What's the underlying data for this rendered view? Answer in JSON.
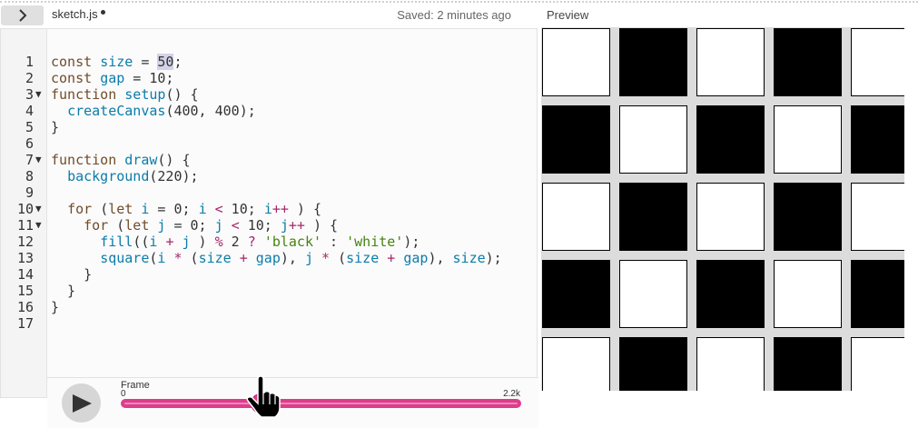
{
  "header": {
    "filename": "sketch.js",
    "saved_status": "Saved: 2 minutes ago",
    "preview_label": "Preview",
    "toggle_icon": "chevron-right-icon"
  },
  "editor": {
    "lines": [
      {
        "n": "1",
        "fold": false,
        "tokens": [
          [
            "kw",
            "const "
          ],
          [
            "var",
            "size"
          ],
          [
            "",
            "  = "
          ],
          [
            "hl",
            "50"
          ],
          [
            "",
            ";"
          ]
        ]
      },
      {
        "n": "2",
        "fold": false,
        "tokens": [
          [
            "kw",
            "const "
          ],
          [
            "var",
            "gap"
          ],
          [
            "",
            ""
          ],
          [
            "",
            ""
          ],
          [
            "",
            ""
          ]
        ]
      },
      {
        "n": "3",
        "fold": true,
        "tokens": []
      },
      {
        "n": "4",
        "fold": false,
        "tokens": []
      },
      {
        "n": "5",
        "fold": false,
        "tokens": []
      },
      {
        "n": "6",
        "fold": false,
        "tokens": []
      },
      {
        "n": "7",
        "fold": true,
        "tokens": []
      },
      {
        "n": "8",
        "fold": false,
        "tokens": []
      },
      {
        "n": "9",
        "fold": false,
        "tokens": []
      },
      {
        "n": "10",
        "fold": true,
        "tokens": []
      },
      {
        "n": "11",
        "fold": true,
        "tokens": []
      },
      {
        "n": "12",
        "fold": false,
        "tokens": []
      },
      {
        "n": "13",
        "fold": false,
        "tokens": []
      },
      {
        "n": "14",
        "fold": false,
        "tokens": []
      },
      {
        "n": "15",
        "fold": false,
        "tokens": []
      },
      {
        "n": "16",
        "fold": false,
        "tokens": []
      },
      {
        "n": "17",
        "fold": false,
        "tokens": []
      }
    ],
    "code": [
      [
        [
          "kw",
          "const "
        ],
        [
          "var",
          "size"
        ],
        [
          "",
          " = "
        ],
        [
          "hl",
          "50"
        ],
        [
          "",
          ";"
        ]
      ],
      [
        [
          "kw",
          "const "
        ],
        [
          "var",
          "gap"
        ],
        [
          "",
          " = 10;"
        ]
      ],
      [
        [
          "kw",
          "function "
        ],
        [
          "var",
          "setup"
        ],
        [
          "",
          "() {"
        ]
      ],
      [
        [
          "",
          "  "
        ],
        [
          "var",
          "createCanvas"
        ],
        [
          "",
          "(400, 400);"
        ]
      ],
      [
        [
          "",
          "}"
        ]
      ],
      [],
      [
        [
          "kw",
          "function "
        ],
        [
          "var",
          "draw"
        ],
        [
          "",
          "() {"
        ]
      ],
      [
        [
          "",
          "  "
        ],
        [
          "var",
          "background"
        ],
        [
          "",
          "(220);"
        ]
      ],
      [],
      [
        [
          "",
          "  "
        ],
        [
          "kw",
          "for "
        ],
        [
          "",
          "("
        ],
        [
          "kw",
          "let "
        ],
        [
          "var",
          "i"
        ],
        [
          "",
          " = 0; "
        ],
        [
          "var",
          "i"
        ],
        [
          "",
          " "
        ],
        [
          "op",
          "<"
        ],
        [
          "",
          " 10; "
        ],
        [
          "var",
          "i"
        ],
        [
          "op",
          "++"
        ],
        [
          "",
          " ) {"
        ]
      ],
      [
        [
          "",
          "    "
        ],
        [
          "kw",
          "for "
        ],
        [
          "",
          "("
        ],
        [
          "kw",
          "let "
        ],
        [
          "var",
          "j"
        ],
        [
          "",
          " = 0; "
        ],
        [
          "var",
          "j"
        ],
        [
          "",
          " "
        ],
        [
          "op",
          "<"
        ],
        [
          "",
          " 10; "
        ],
        [
          "var",
          "j"
        ],
        [
          "op",
          "++"
        ],
        [
          "",
          " ) {"
        ]
      ],
      [
        [
          "",
          "      "
        ],
        [
          "var",
          "fill"
        ],
        [
          "",
          "(("
        ],
        [
          "var",
          "i"
        ],
        [
          "",
          " "
        ],
        [
          "op",
          "+"
        ],
        [
          "",
          " "
        ],
        [
          "var",
          "j"
        ],
        [
          "",
          " ) "
        ],
        [
          "op",
          "%"
        ],
        [
          "",
          " 2 "
        ],
        [
          "op",
          "?"
        ],
        [
          "",
          " "
        ],
        [
          "str",
          "'black'"
        ],
        [
          "",
          " : "
        ],
        [
          "str",
          "'white'"
        ],
        [
          "",
          ");"
        ]
      ],
      [
        [
          "",
          "      "
        ],
        [
          "var",
          "square"
        ],
        [
          "",
          "("
        ],
        [
          "var",
          "i"
        ],
        [
          "",
          " "
        ],
        [
          "op",
          "*"
        ],
        [
          "",
          " ("
        ],
        [
          "var",
          "size"
        ],
        [
          "",
          " "
        ],
        [
          "op",
          "+"
        ],
        [
          "",
          " "
        ],
        [
          "var",
          "gap"
        ],
        [
          "",
          "), "
        ],
        [
          "var",
          "j"
        ],
        [
          "",
          " "
        ],
        [
          "op",
          "*"
        ],
        [
          "",
          " ("
        ],
        [
          "var",
          "size"
        ],
        [
          "",
          " "
        ],
        [
          "op",
          "+"
        ],
        [
          "",
          " "
        ],
        [
          "var",
          "gap"
        ],
        [
          "",
          "), "
        ],
        [
          "var",
          "size"
        ],
        [
          "",
          ");"
        ]
      ],
      [
        [
          "",
          "    }"
        ]
      ],
      [
        [
          "",
          "  }"
        ]
      ],
      [
        [
          "",
          "}"
        ]
      ],
      []
    ]
  },
  "controls": {
    "play_icon": "play-icon",
    "frame_label": "Frame",
    "frame_min": "0",
    "frame_max": "2.2k",
    "frame_fraction": 0.35
  },
  "preview": {
    "grid_size": 10,
    "cell_pattern": "checkerboard",
    "background": "#dcdcdc"
  },
  "colors": {
    "accent": "#de3d8c",
    "keyword": "#704c2a",
    "identifier": "#0b7ca9",
    "string": "#47820f",
    "operator": "#a6276a"
  }
}
